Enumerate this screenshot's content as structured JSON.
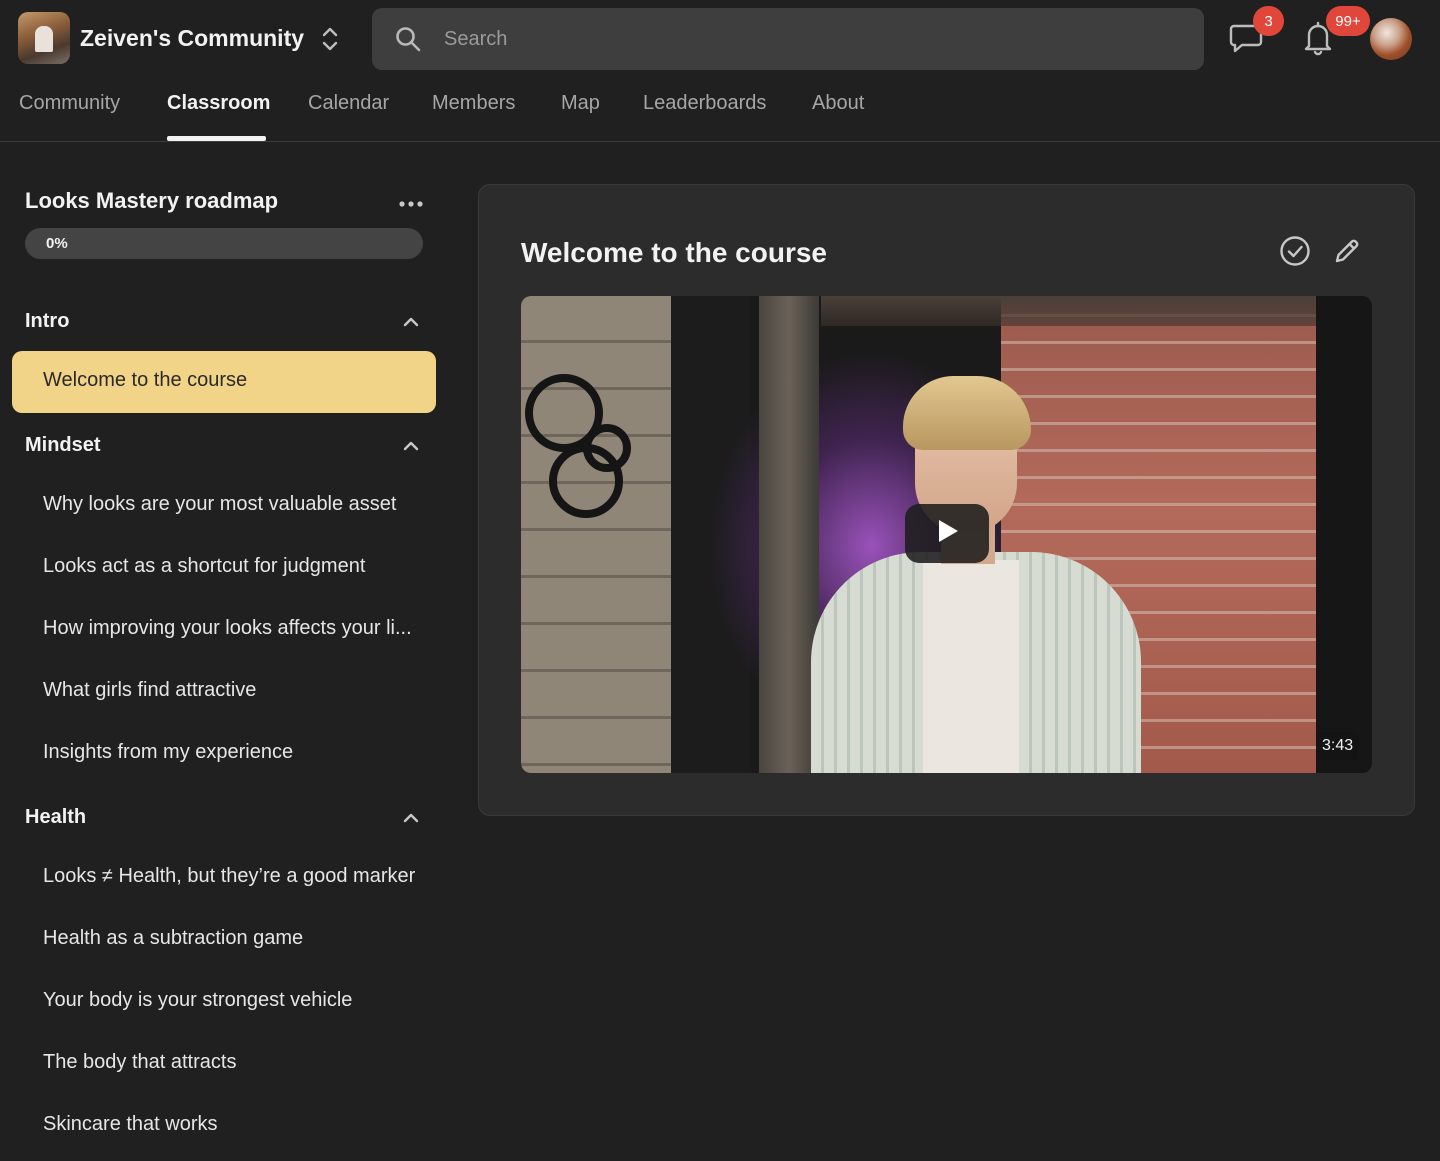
{
  "header": {
    "community_name": "Zeiven's Community",
    "search_placeholder": "Search",
    "chat_badge": "3",
    "notifications_badge": "99+"
  },
  "nav": {
    "tabs": [
      "Community",
      "Classroom",
      "Calendar",
      "Members",
      "Map",
      "Leaderboards",
      "About"
    ],
    "active_tab": "Classroom"
  },
  "sidebar": {
    "roadmap_title": "Looks Mastery roadmap",
    "progress": 0,
    "progress_label": "0%",
    "sections": [
      {
        "title": "Intro",
        "expanded": true,
        "lessons": [
          "Welcome to the course"
        ]
      },
      {
        "title": "Mindset",
        "expanded": true,
        "lessons": [
          "Why looks are your most valuable asset",
          "Looks act as a shortcut for judgment",
          "How improving your looks affects your li...",
          "What girls find attractive",
          "Insights from my experience"
        ]
      },
      {
        "title": "Health",
        "expanded": true,
        "lessons": [
          "Looks ≠ Health, but they’re a good marker",
          "Health as a subtraction game",
          "Your body is your strongest vehicle",
          "The body that attracts",
          "Skincare that works"
        ]
      }
    ],
    "active_lesson": "Welcome to the course"
  },
  "main": {
    "lesson_title": "Welcome to the course",
    "video_duration": "3:43"
  },
  "colors": {
    "background": "#202020",
    "card": "#2c2c2c",
    "accent": "#f2d488",
    "badge": "#e0463a",
    "search_bg": "#3e3e3e"
  },
  "icons": {
    "brand_switch": "chevron-up-down-icon",
    "search": "search-icon",
    "chat": "chat-bubble-icon",
    "notifications": "bell-icon",
    "more": "more-horizontal-icon",
    "section_toggle": "chevron-up-icon",
    "complete": "check-circle-icon",
    "edit": "pencil-icon",
    "play": "play-icon"
  }
}
